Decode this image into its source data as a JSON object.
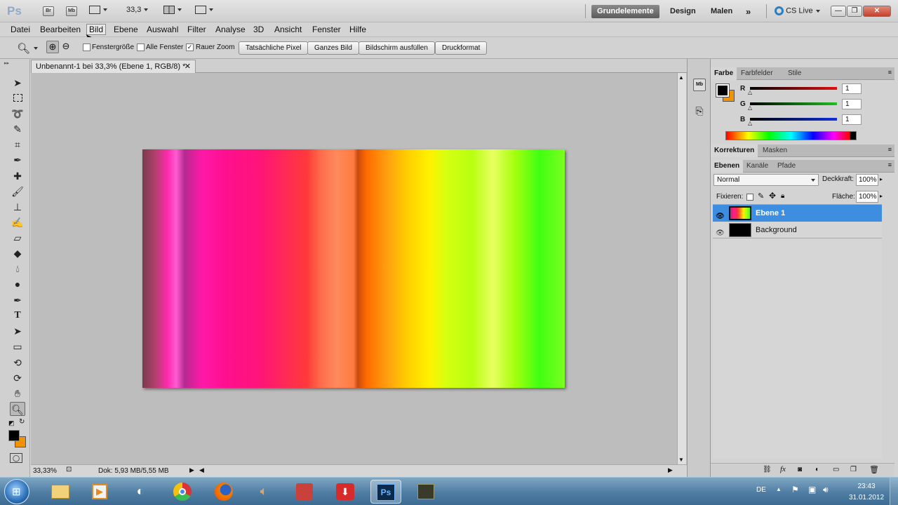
{
  "app": {
    "logo": "Ps",
    "zoom_value": "33,3"
  },
  "workspaces": [
    "Grundelemente",
    "Design",
    "Malen"
  ],
  "cs_live": "CS Live",
  "appbar_buttons": {
    "bridge": "Br",
    "mini_bridge": "Mb"
  },
  "window_controls": {
    "minimize": "—",
    "maximize": "❐",
    "close": "✕"
  },
  "menu": [
    "Datei",
    "Bearbeiten",
    "Bild",
    "Ebene",
    "Auswahl",
    "Filter",
    "Analyse",
    "3D",
    "Ansicht",
    "Fenster",
    "Hilfe"
  ],
  "options": {
    "checkboxes": [
      {
        "label": "Fenstergröße",
        "checked": false
      },
      {
        "label": "Alle Fenster",
        "checked": false
      },
      {
        "label": "Rauer Zoom",
        "checked": true
      }
    ],
    "buttons": [
      "Tatsächliche Pixel",
      "Ganzes Bild",
      "Bildschirm ausfüllen",
      "Druckformat"
    ]
  },
  "document": {
    "tab_title": "Unbenannt-1 bei 33,3% (Ebene 1, RGB/8) *",
    "zoom_status": "33,33%",
    "doc_status": "Dok: 5,93 MB/5,55 MB"
  },
  "color_panel": {
    "tabs": [
      "Farbe",
      "Farbfelder",
      "Stile"
    ],
    "sliders": [
      {
        "label": "R",
        "value": "1",
        "color": "#d01010"
      },
      {
        "label": "G",
        "value": "1",
        "color": "#10b010"
      },
      {
        "label": "B",
        "value": "1",
        "color": "#1020d0"
      }
    ],
    "foreground": "#000000",
    "background": "#f39200"
  },
  "adjust_panel": {
    "tabs": [
      "Korrekturen",
      "Masken"
    ]
  },
  "layers_panel": {
    "tabs": [
      "Ebenen",
      "Kanäle",
      "Pfade"
    ],
    "blend_mode": "Normal",
    "opacity_label": "Deckkraft:",
    "opacity_value": "100%",
    "lock_label": "Fixieren:",
    "fill_label": "Fläche:",
    "fill_value": "100%",
    "layers": [
      {
        "name": "Ebene 1",
        "selected": true
      },
      {
        "name": "Background",
        "selected": false
      }
    ]
  },
  "taskbar": {
    "lang": "DE",
    "time": "23:43",
    "date": "31.01.2012"
  }
}
